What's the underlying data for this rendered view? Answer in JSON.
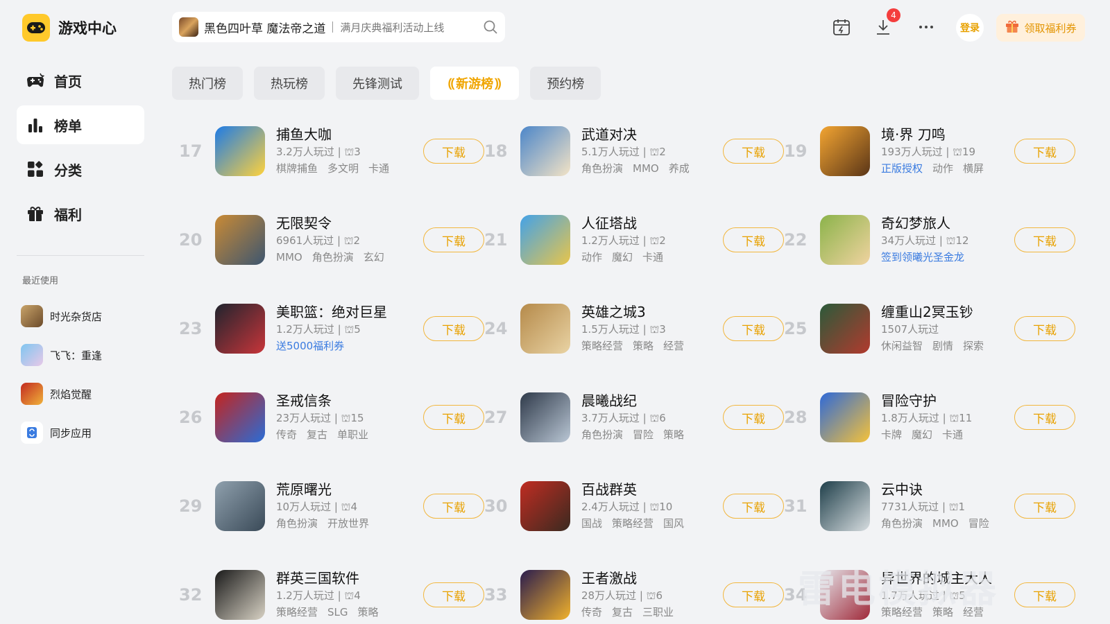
{
  "app": {
    "title": "游戏中心"
  },
  "sidebar": {
    "items": [
      {
        "label": "首页",
        "icon": "gamepad-icon"
      },
      {
        "label": "榜单",
        "icon": "bar-chart-icon",
        "active": true
      },
      {
        "label": "分类",
        "icon": "category-icon"
      },
      {
        "label": "福利",
        "icon": "gift-icon"
      }
    ],
    "recent_title": "最近使用",
    "recent": [
      {
        "label": "时光杂货店"
      },
      {
        "label": "飞飞：重逢"
      },
      {
        "label": "烈焰觉醒"
      },
      {
        "label": "同步应用"
      }
    ]
  },
  "search": {
    "game": "黑色四叶草 魔法帝之道",
    "promo": "满月庆典福利活动上线"
  },
  "header": {
    "download_badge": "4",
    "login_label": "登录",
    "coupon_label": "领取福利券"
  },
  "tabs": [
    {
      "label": "热门榜"
    },
    {
      "label": "热玩榜"
    },
    {
      "label": "先锋测试"
    },
    {
      "label": "新游榜",
      "active": true
    },
    {
      "label": "预约榜"
    }
  ],
  "download_label": "下载",
  "games": [
    {
      "rank": "17",
      "name": "捕鱼大咖",
      "meta": "3.2万人玩过 | ⛫3",
      "tags": [
        "棋牌捕鱼",
        "多文明",
        "卡通"
      ],
      "colors": [
        "#1e7be6",
        "#ffd23c"
      ]
    },
    {
      "rank": "18",
      "name": "武道对决",
      "meta": "5.1万人玩过 | ⛫2",
      "tags": [
        "角色扮演",
        "MMO",
        "养成"
      ],
      "colors": [
        "#4c86c9",
        "#f3e3c6"
      ]
    },
    {
      "rank": "19",
      "name": "境·界 刀鸣",
      "meta": "193万人玩过 | ⛫19",
      "tags": [
        "正版授权",
        "动作",
        "横屏"
      ],
      "promo_first": true,
      "colors": [
        "#f3a532",
        "#5a3517"
      ]
    },
    {
      "rank": "20",
      "name": "无限契令",
      "meta": "6961人玩过 | ⛫2",
      "tags": [
        "MMO",
        "角色扮演",
        "玄幻"
      ],
      "colors": [
        "#c98a35",
        "#3d5670"
      ]
    },
    {
      "rank": "21",
      "name": "人征塔战",
      "meta": "1.2万人玩过 | ⛫2",
      "tags": [
        "动作",
        "魔幻",
        "卡通"
      ],
      "colors": [
        "#43a2e8",
        "#e8c54a"
      ]
    },
    {
      "rank": "22",
      "name": "奇幻梦旅人",
      "meta": "34万人玩过 | ⛫12",
      "promo": "签到领曦光圣金龙",
      "colors": [
        "#8bb34a",
        "#f0d3a0"
      ]
    },
    {
      "rank": "23",
      "name": "美职篮：绝对巨星",
      "meta": "1.2万人玩过 | ⛫5",
      "promo": "送5000福利券",
      "colors": [
        "#20242e",
        "#c8353a"
      ]
    },
    {
      "rank": "24",
      "name": "英雄之城3",
      "meta": "1.5万人玩过 | ⛫3",
      "tags": [
        "策略经营",
        "策略",
        "经营"
      ],
      "colors": [
        "#b58a4a",
        "#e9d3a4"
      ]
    },
    {
      "rank": "25",
      "name": "缠重山2冥玉钞",
      "meta": "1507人玩过",
      "tags": [
        "休闲益智",
        "剧情",
        "探索"
      ],
      "colors": [
        "#2b5a3a",
        "#b23a2e"
      ]
    },
    {
      "rank": "26",
      "name": "圣戒信条",
      "meta": "23万人玩过 | ⛫15",
      "tags": [
        "传奇",
        "复古",
        "单职业"
      ],
      "colors": [
        "#c4241e",
        "#2a6cd6"
      ]
    },
    {
      "rank": "27",
      "name": "晨曦战纪",
      "meta": "3.7万人玩过 | ⛫6",
      "tags": [
        "角色扮演",
        "冒险",
        "策略"
      ],
      "colors": [
        "#2f3a4a",
        "#b9c6d4"
      ]
    },
    {
      "rank": "28",
      "name": "冒险守护",
      "meta": "1.8万人玩过 | ⛫11",
      "tags": [
        "卡牌",
        "魔幻",
        "卡通"
      ],
      "colors": [
        "#2e69d8",
        "#f5c23a"
      ]
    },
    {
      "rank": "29",
      "name": "荒原曙光",
      "meta": "10万人玩过 | ⛫4",
      "tags": [
        "角色扮演",
        "开放世界"
      ],
      "colors": [
        "#8fa0ad",
        "#3a4a58"
      ]
    },
    {
      "rank": "30",
      "name": "百战群英",
      "meta": "2.4万人玩过 | ⛫10",
      "tags": [
        "国战",
        "策略经营",
        "国风"
      ],
      "colors": [
        "#c02c22",
        "#3a2a20"
      ]
    },
    {
      "rank": "31",
      "name": "云中诀",
      "meta": "7731人玩过 | ⛫1",
      "tags": [
        "角色扮演",
        "MMO",
        "冒险"
      ],
      "colors": [
        "#1f3f4a",
        "#d7dde0"
      ]
    },
    {
      "rank": "32",
      "name": "群英三国软件",
      "meta": "1.2万人玩过 | ⛫4",
      "tags": [
        "策略经营",
        "SLG",
        "策略"
      ],
      "colors": [
        "#1a1a1a",
        "#d8d2c4"
      ]
    },
    {
      "rank": "33",
      "name": "王者激战",
      "meta": "28万人玩过 | ⛫6",
      "tags": [
        "传奇",
        "复古",
        "三职业"
      ],
      "colors": [
        "#2a1c4e",
        "#f1b22c"
      ]
    },
    {
      "rank": "34",
      "name": "异世界的城主大人",
      "meta": "1.7万人玩过 | ⛫5",
      "tags": [
        "策略经营",
        "策略",
        "经营"
      ],
      "colors": [
        "#e5e5ea",
        "#a02a3a"
      ]
    }
  ],
  "watermark": "雷电模拟器"
}
